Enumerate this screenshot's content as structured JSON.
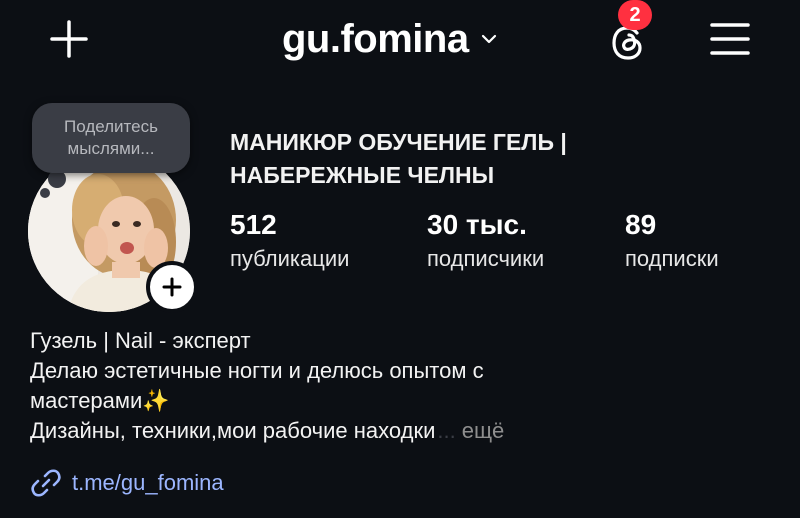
{
  "header": {
    "username": "gu.fomina",
    "notifications_count": "2",
    "icons": [
      "plus-icon",
      "chevron-down-icon",
      "threads-icon",
      "menu-icon"
    ]
  },
  "profile": {
    "note": "Поделитесь мыслями...",
    "category": "МАНИКЮР ОБУЧЕНИЕ ГЕЛЬ |\nНАБЕРЕЖНЫЕ ЧЕЛНЫ",
    "stats": [
      {
        "value": "512",
        "label": "публикации"
      },
      {
        "value": "30 тыс.",
        "label": "подписчики"
      },
      {
        "value": "89",
        "label": "подписки"
      }
    ]
  },
  "bio": {
    "line1": "Гузель | Nail - эксперт",
    "line2": "Делаю эстетичные ногти и делюсь опытом с",
    "line3": "мастерами",
    "line3_emoji": "✨",
    "line4": "Дизайны, техники,мои рабочие находки",
    "ellipsis": "...",
    "more_label": "ещё",
    "link": "t.me/gu_fomina"
  },
  "colors": {
    "background": "#0c0f14",
    "badge": "#ff3040",
    "link": "#9cb6ff",
    "note_bubble": "#3a3d45"
  }
}
